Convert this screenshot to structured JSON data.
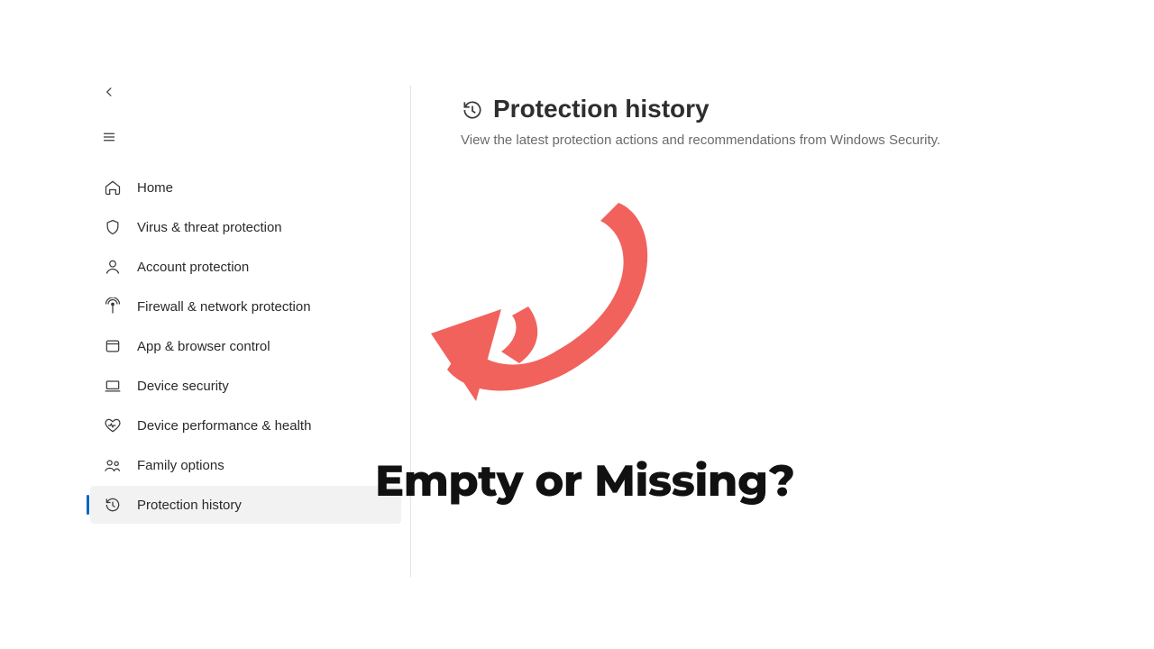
{
  "sidebar": {
    "items": [
      {
        "label": "Home"
      },
      {
        "label": "Virus & threat protection"
      },
      {
        "label": "Account protection"
      },
      {
        "label": "Firewall & network protection"
      },
      {
        "label": "App & browser control"
      },
      {
        "label": "Device security"
      },
      {
        "label": "Device performance & health"
      },
      {
        "label": "Family options"
      },
      {
        "label": "Protection history"
      }
    ],
    "selected_index": 8
  },
  "main": {
    "title": "Protection history",
    "subtitle": "View the latest protection actions and recommendations from Windows Security."
  },
  "annotation": {
    "caption": "Empty or Missing?",
    "arrow_color": "#f1625d"
  }
}
